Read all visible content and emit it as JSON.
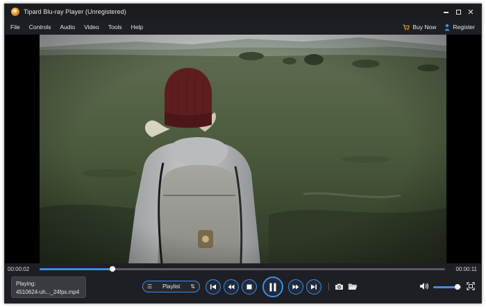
{
  "window": {
    "title": "Tipard Blu-ray Player (Unregistered)",
    "icons": {
      "logo": "app-logo-icon",
      "minimize": "minimize-icon",
      "maximize": "maximize-icon",
      "close": "close-icon"
    }
  },
  "menu": {
    "items": [
      {
        "label": "File"
      },
      {
        "label": "Controls"
      },
      {
        "label": "Audio"
      },
      {
        "label": "Video"
      },
      {
        "label": "Tools"
      },
      {
        "label": "Help"
      }
    ],
    "buy_now": "Buy Now",
    "register": "Register",
    "accent_color": "#3d8ee8"
  },
  "player": {
    "elapsed": "00:00:02",
    "duration": "00:00:11",
    "progress_fraction": 0.18,
    "now_playing_label": "Playing:",
    "now_playing_file": "4510624-uh..._24fps.mp4",
    "playlist_label": "Playlist",
    "volume_fraction": 0.88,
    "controls": [
      "previous-icon",
      "rewind-icon",
      "stop-icon",
      "pause-icon",
      "fast-forward-icon",
      "next-icon"
    ],
    "tools": [
      "snapshot-camera-icon",
      "open-folder-icon",
      "volume-icon",
      "fullscreen-icon"
    ]
  }
}
